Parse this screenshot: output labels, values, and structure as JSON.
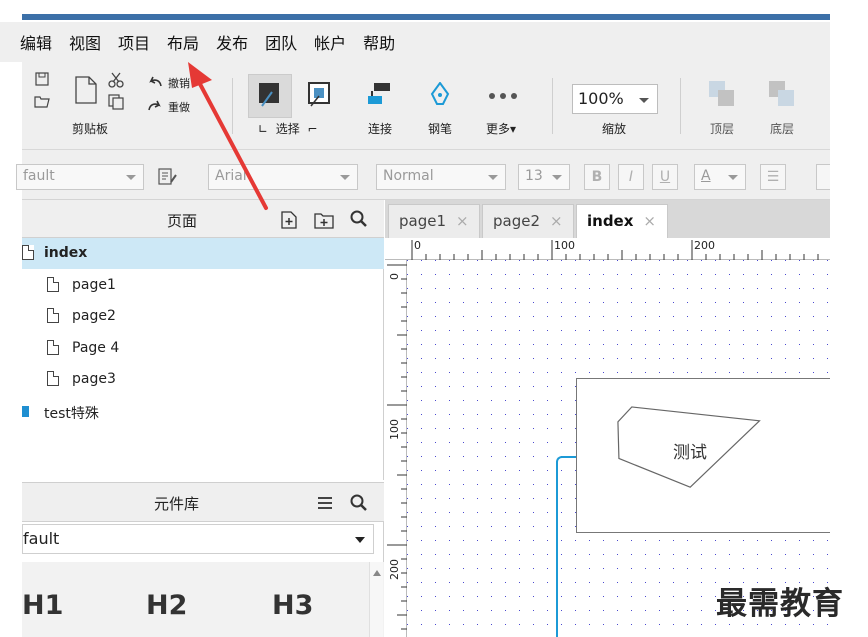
{
  "menu": {
    "items": [
      "编辑",
      "视图",
      "项目",
      "布局",
      "发布",
      "团队",
      "帐户",
      "帮助"
    ],
    "leading_fragment": "ɨ"
  },
  "toolbar": {
    "clipboard_label": "剪贴板",
    "undo_label": "撤销",
    "redo_label": "重做",
    "select_label": "选择",
    "connect_label": "连接",
    "pen_label": "钢笔",
    "more_label": "更多▾",
    "zoom_value": "100%",
    "zoom_label": "缩放",
    "top_label": "顶层",
    "bottom_label": "底层"
  },
  "format": {
    "font_family_partial": "fault",
    "font_name": "Arial",
    "style": "Normal",
    "size": "13",
    "bold": "B",
    "italic": "I",
    "underline": "U",
    "font_color": "A"
  },
  "pages": {
    "title": "页面",
    "items": [
      {
        "label": "index",
        "selected": true
      },
      {
        "label": "page1"
      },
      {
        "label": "page2"
      },
      {
        "label": "Page 4"
      },
      {
        "label": "page3"
      },
      {
        "label": "test特殊",
        "folder": true
      }
    ]
  },
  "library": {
    "title": "元件库",
    "selected": "fault",
    "widgets": [
      "H1",
      "H2",
      "H3"
    ]
  },
  "tabs": [
    {
      "label": "page1",
      "active": false
    },
    {
      "label": "page2",
      "active": false
    },
    {
      "label": "index",
      "active": true
    }
  ],
  "tab_close": "×",
  "rulers": {
    "top": [
      "0",
      "100",
      "200"
    ],
    "left": [
      "0",
      "100",
      "200"
    ]
  },
  "canvas": {
    "shape_text": "测试"
  },
  "watermark": "最需教育",
  "colors": {
    "accent": "#1c9ad6",
    "selection": "#cde8f6",
    "arrow": "#e53935"
  }
}
